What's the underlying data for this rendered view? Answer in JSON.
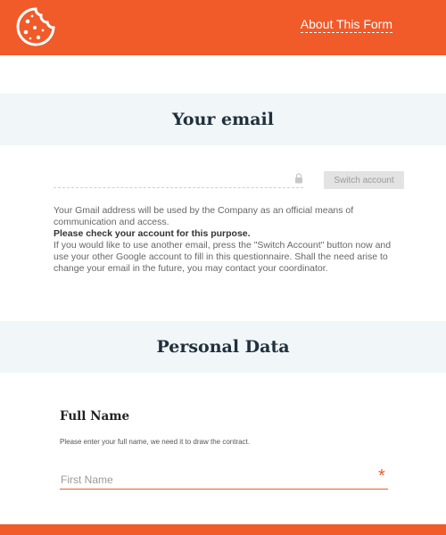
{
  "colors": {
    "accent": "#f15a29",
    "band": "#f1f6f9"
  },
  "header": {
    "logo_icon": "cookie-icon",
    "about_link": "About This Form"
  },
  "email_section": {
    "title": "Your email",
    "email_value": "",
    "lock_icon": "lock-icon",
    "switch_button": "Switch account",
    "info_line1": "Your Gmail address will be used by the Company as an official means of communication and access.",
    "info_bold": "Please check your account for this purpose.",
    "info_line2": "If you would like to use another email, press the \"Switch Account\" button now and use your other Google account to fill in this questionnaire. Shall the need arise to change your email in the future, you may contact your coordinator."
  },
  "personal_section": {
    "title": "Personal Data",
    "full_name": {
      "title": "Full Name",
      "hint": "Please enter your full name, we need it to draw the contract.",
      "first_name_placeholder": "First Name",
      "first_name_value": "",
      "required_mark": "*"
    }
  }
}
